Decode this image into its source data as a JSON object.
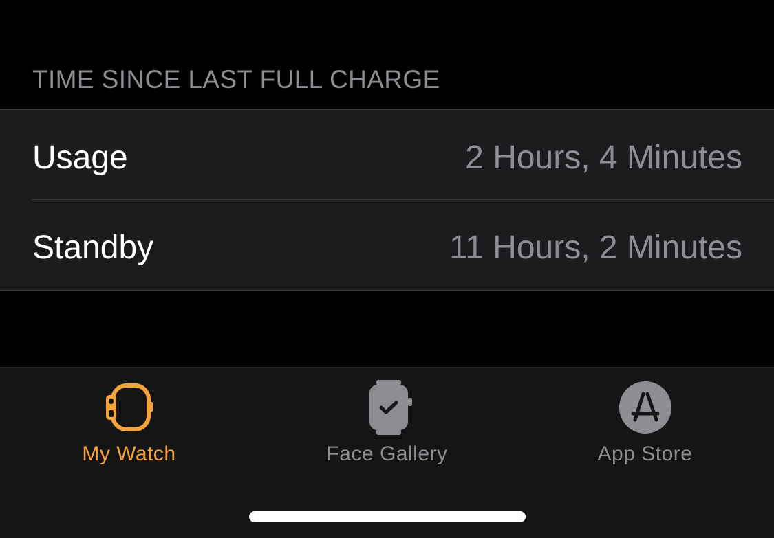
{
  "section": {
    "header": "TIME SINCE LAST FULL CHARGE"
  },
  "rows": [
    {
      "label": "Usage",
      "value": "2 Hours, 4 Minutes"
    },
    {
      "label": "Standby",
      "value": "11 Hours, 2 Minutes"
    }
  ],
  "tabbar": {
    "tabs": [
      {
        "label": "My Watch",
        "icon": "watch-icon",
        "active": true
      },
      {
        "label": "Face Gallery",
        "icon": "watch-face-icon",
        "active": false
      },
      {
        "label": "App Store",
        "icon": "app-store-icon",
        "active": false
      }
    ]
  },
  "colors": {
    "accent": "#f7a33c",
    "inactive": "#8d8d93",
    "background": "#000000",
    "cell": "#1c1c1e"
  }
}
